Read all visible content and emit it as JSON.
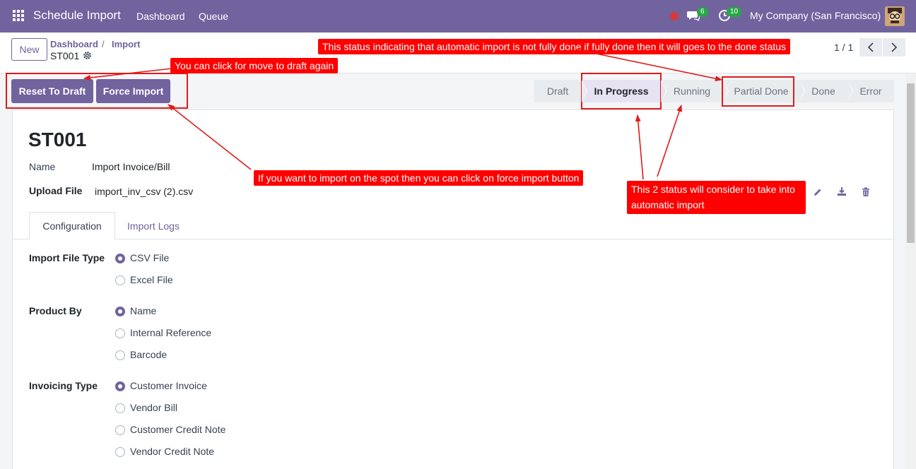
{
  "navbar": {
    "brand": "Schedule Import",
    "links": [
      "Dashboard",
      "Queue"
    ],
    "messages_count": "6",
    "activities_count": "10",
    "company": "My Company (San Francisco)"
  },
  "control": {
    "new_label": "New",
    "breadcrumb": [
      "Dashboard",
      "Import"
    ],
    "breadcrumb_sep": "/",
    "record": "ST001",
    "pager": "1 / 1"
  },
  "actions": {
    "reset_label": "Reset To Draft",
    "force_label": "Force Import"
  },
  "statusbar": {
    "stages": [
      "Draft",
      "In Progress",
      "Running",
      "Partial Done",
      "Done",
      "Error"
    ],
    "active": "In Progress"
  },
  "form": {
    "title": "ST001",
    "name_label": "Name",
    "name_value": "Import Invoice/Bill",
    "upload_label": "Upload File",
    "upload_value": "import_inv_csv (2).csv",
    "tabs": [
      "Configuration",
      "Import Logs"
    ],
    "import_file_type": {
      "label": "Import File Type",
      "options": [
        "CSV File",
        "Excel File"
      ],
      "selected": "CSV File"
    },
    "product_by": {
      "label": "Product By",
      "options": [
        "Name",
        "Internal Reference",
        "Barcode"
      ],
      "selected": "Name"
    },
    "invoicing_type": {
      "label": "Invoicing Type",
      "options": [
        "Customer Invoice",
        "Vendor Bill",
        "Customer Credit Note",
        "Vendor Credit Note"
      ],
      "selected": "Customer Invoice"
    }
  },
  "annotations": {
    "status_note": "This status indicating that automatic import is not fully done if fully done then it will goes to the done status",
    "draft_note": "You can click for move to draft again",
    "force_note": "If you want to import on the spot then you can click on force import button",
    "two_status_note_line1": "This 2 status will consider to take into",
    "two_status_note_line2": "automatic import"
  },
  "colors": {
    "navbar": "#71639e",
    "primary": "#71639e",
    "annotation": "#ff0000"
  }
}
